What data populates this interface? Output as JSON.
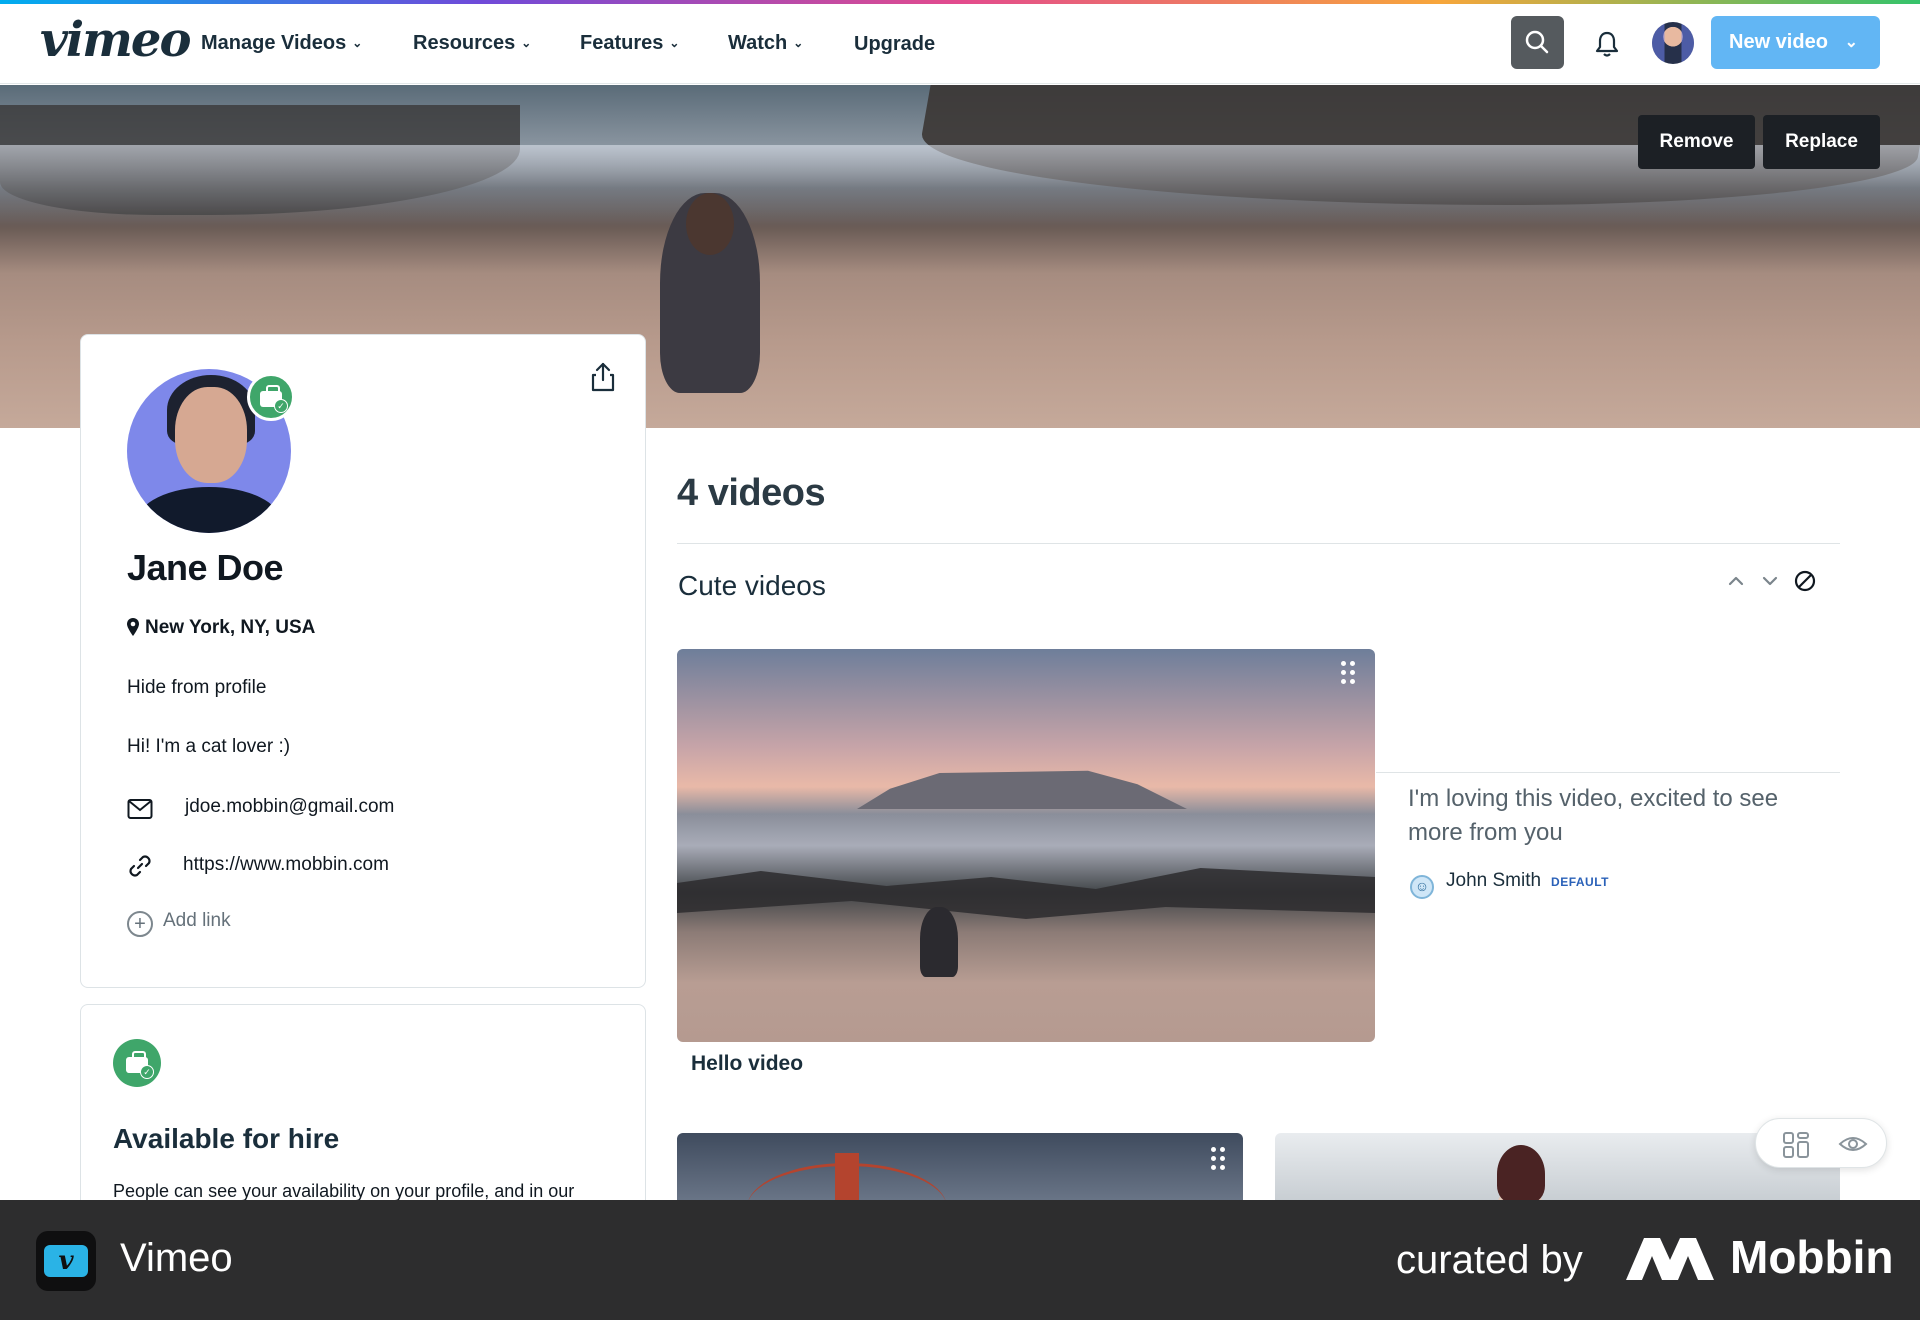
{
  "header": {
    "logo": "vimeo",
    "nav": [
      {
        "label": "Manage Videos",
        "has_chevron": true
      },
      {
        "label": "Resources",
        "has_chevron": true
      },
      {
        "label": "Features",
        "has_chevron": true
      },
      {
        "label": "Watch",
        "has_chevron": true
      },
      {
        "label": "Upgrade",
        "has_chevron": false
      }
    ],
    "chevron": "⌄",
    "new_video_label": "New video",
    "new_video_chevron": "⌄",
    "icons": [
      "search-icon",
      "bell-icon",
      "user-avatar",
      "chevron-down-icon"
    ]
  },
  "banner": {
    "remove_label": "Remove",
    "replace_label": "Replace"
  },
  "profile": {
    "name": "Jane Doe",
    "location": "New York, NY, USA",
    "hide_label": "Hide from profile",
    "bio": "Hi! I'm a cat lover :)",
    "email": "jdoe.mobbin@gmail.com",
    "website": "https://www.mobbin.com",
    "add_link_label": "Add link",
    "icons": [
      "share-icon",
      "location-pin-icon",
      "mail-icon",
      "link-icon",
      "plus-circle-icon",
      "briefcase-check-icon"
    ]
  },
  "hire": {
    "title": "Available for hire",
    "description": "People can see your availability on your profile, and in our"
  },
  "content": {
    "videos_count": "4 videos",
    "section_title": "Cute videos",
    "section_controls": [
      "chevron-up-icon",
      "chevron-down-icon",
      "hide-icon"
    ],
    "featured_video_title": "Hello video",
    "comment": {
      "text": "I'm loving this video, excited to see more from you",
      "author": "John Smith",
      "tag": "DEFAULT"
    },
    "float_tools": [
      "layout-icon",
      "eye-icon"
    ]
  },
  "footer": {
    "app_name": "Vimeo",
    "app_icon_letter": "v",
    "curated_by": "curated by",
    "brand": "Mobbin"
  },
  "colors": {
    "primary_button": "#62b6f4",
    "text_dark": "#1a2e3b",
    "hire_green": "#3fa66a",
    "footer_bg": "#2d2d2e",
    "tag_blue": "#2a61b8"
  }
}
